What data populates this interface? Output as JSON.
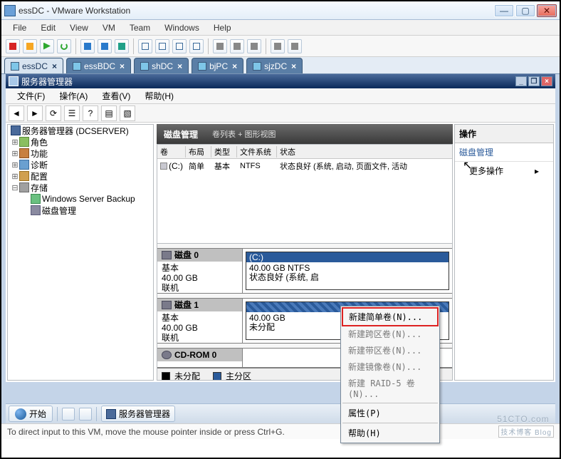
{
  "outer_window": {
    "title": "essDC - VMware Workstation",
    "btn_min": "—",
    "btn_max": "▢",
    "btn_close": "✕"
  },
  "menubar": [
    "File",
    "Edit",
    "View",
    "VM",
    "Team",
    "Windows",
    "Help"
  ],
  "tabs": [
    {
      "label": "essDC",
      "active": true
    },
    {
      "label": "essBDC",
      "active": false
    },
    {
      "label": "shDC",
      "active": false
    },
    {
      "label": "bjPC",
      "active": false
    },
    {
      "label": "sjzDC",
      "active": false
    }
  ],
  "mmc": {
    "title": "服务器管理器",
    "btn_min": "_",
    "btn_restore": "❐",
    "btn_close": "×",
    "menubar": [
      "文件(F)",
      "操作(A)",
      "查看(V)",
      "帮助(H)"
    ]
  },
  "tree": {
    "root": "服务器管理器 (DCSERVER)",
    "roles": "角色",
    "features": "功能",
    "diag": "诊断",
    "config": "配置",
    "storage": "存储",
    "backup": "Windows Server Backup",
    "diskmgmt": "磁盘管理"
  },
  "center_header": {
    "title": "磁盘管理",
    "subtitle": "卷列表 + 图形视图"
  },
  "vol_list": {
    "headers": {
      "vol": "卷",
      "layout": "布局",
      "type": "类型",
      "fs": "文件系统",
      "status": "状态"
    },
    "row0": {
      "vol": "(C:)",
      "layout": "简单",
      "type": "基本",
      "fs": "NTFS",
      "status": "状态良好 (系统, 启动, 页面文件, 活动"
    }
  },
  "disks": {
    "d0": {
      "name": "磁盘 0",
      "type": "基本",
      "size": "40.00 GB",
      "state": "联机",
      "vol": {
        "title": "(C:)",
        "l2": "40.00 GB NTFS",
        "l3": "状态良好 (系统, 启"
      }
    },
    "d1": {
      "name": "磁盘 1",
      "type": "基本",
      "size": "40.00 GB",
      "state": "联机",
      "vol": {
        "l2": "40.00 GB",
        "l3": "未分配"
      }
    },
    "cd": {
      "name": "CD-ROM 0"
    }
  },
  "legend": {
    "unalloc": "未分配",
    "primary": "主分区"
  },
  "actions": {
    "pane_title": "操作",
    "section": "磁盘管理",
    "more": "更多操作",
    "chevron": "▸"
  },
  "context_menu": {
    "simple": "新建简单卷(N)...",
    "span": "新建跨区卷(N)...",
    "stripe": "新建带区卷(N)...",
    "mirror": "新建镜像卷(N)...",
    "raid5": "新建 RAID-5 卷(N)...",
    "props": "属性(P)",
    "help": "帮助(H)"
  },
  "taskbar": {
    "start": "开始",
    "task1": "服务器管理器"
  },
  "statusbar": {
    "hint": "To direct input to this VM, move the mouse pointer inside or press Ctrl+G."
  },
  "watermark": {
    "text": "51CTO.com",
    "tag": "技术博客 Blog"
  }
}
